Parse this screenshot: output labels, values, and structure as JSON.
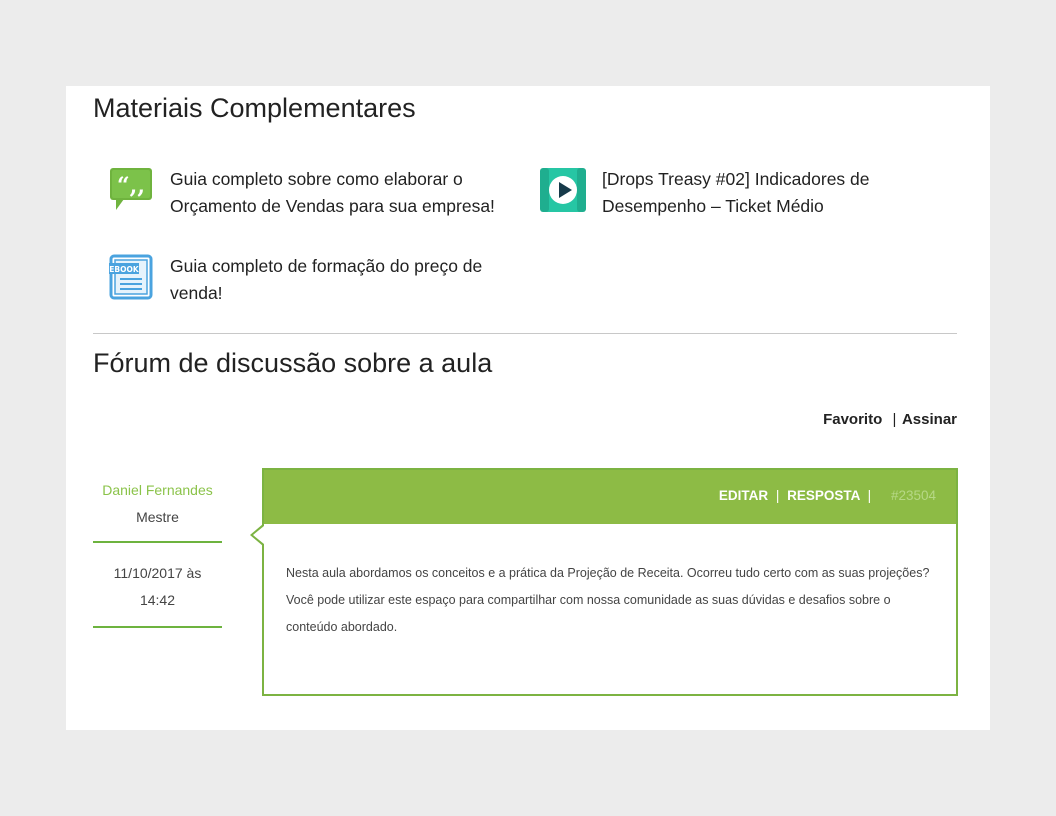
{
  "materials": {
    "title": "Materiais Complementares",
    "items": [
      {
        "text": "Guia completo sobre como elaborar o Orçamento de Vendas para sua empresa!",
        "icon": "quote-bubble-icon"
      },
      {
        "text": "[Drops Treasy #02] Indicadores de Desempenho – Ticket Médio",
        "icon": "video-play-icon"
      },
      {
        "text": "Guia completo de formação do preço de venda!",
        "icon": "ebook-icon",
        "icon_label": "EBOOK"
      }
    ]
  },
  "forum": {
    "title": "Fórum de discussão sobre a aula",
    "actions": {
      "favorite": "Favorito",
      "separator": "|",
      "subscribe": "Assinar"
    },
    "post": {
      "author": "Daniel Fernandes",
      "role": "Mestre",
      "date": "11/10/2017 às",
      "time": "14:42",
      "edit": "EDITAR",
      "reply": "RESPOSTA",
      "separator": "|",
      "id": "#23504",
      "body": "Nesta aula abordamos os conceitos e a prática da Projeção de Receita. Ocorreu tudo certo com as suas projeções? Você pode utilizar este espaço para compartilhar com nossa comunidade as suas dúvidas e desafios sobre o conteúdo abordado."
    }
  },
  "colors": {
    "accent_green": "#8dbb45",
    "border_green": "#7cb342",
    "author_green": "#8bc34a",
    "video_teal": "#26c6a4",
    "ebook_blue": "#4aa3df",
    "quote_green": "#6fb33e"
  }
}
